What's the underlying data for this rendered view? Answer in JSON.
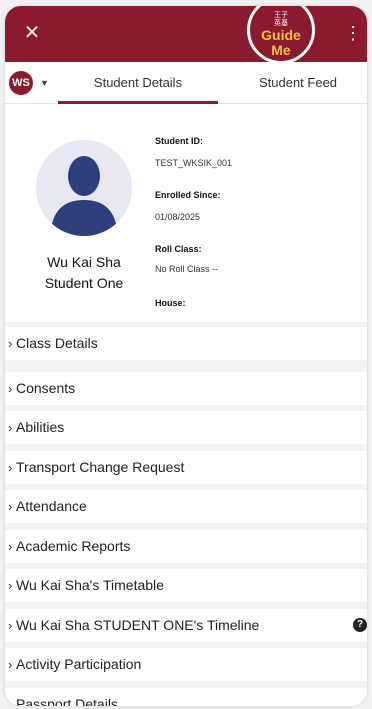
{
  "header": {
    "close_glyph": "✕",
    "guide_cjk": "王子\n英基",
    "guide_line1": "Guide",
    "guide_line2": "Me",
    "more_glyph": "⋮"
  },
  "tabs": {
    "avatar_initials": "WS",
    "caret": "▼",
    "student_details": "Student Details",
    "student_feed": "Student Feed"
  },
  "profile": {
    "name_line1": "Wu Kai Sha",
    "name_line2": "Student One",
    "student_id_label": "Student ID:",
    "student_id_value": "TEST_WKSIK_001",
    "enrolled_label": "Enrolled Since:",
    "enrolled_value": "01/08/2025",
    "roll_class_label": "Roll Class:",
    "roll_class_value": "No Roll Class --",
    "house_label": "House:"
  },
  "sections": [
    {
      "label": "Class Details"
    },
    {
      "label": "Consents"
    },
    {
      "label": "Abilities"
    },
    {
      "label": "Transport Change Request"
    },
    {
      "label": "Attendance"
    },
    {
      "label": "Academic Reports"
    },
    {
      "label": "Wu Kai Sha's Timetable"
    },
    {
      "label": "Wu Kai Sha STUDENT ONE's Timeline"
    },
    {
      "label": "Activity Participation"
    },
    {
      "label": "Passport Details"
    }
  ],
  "timeline_help_glyph": "?",
  "colors": {
    "brand": "#8b1a2f",
    "guide_text": "#f5c23b",
    "avatar_bg": "#e8e8f2",
    "avatar_figure": "#2f3f7e"
  },
  "icons": [
    "close-icon",
    "more-vert-icon",
    "user-silhouette-icon",
    "chevron-right-icon",
    "help-circle-icon"
  ]
}
